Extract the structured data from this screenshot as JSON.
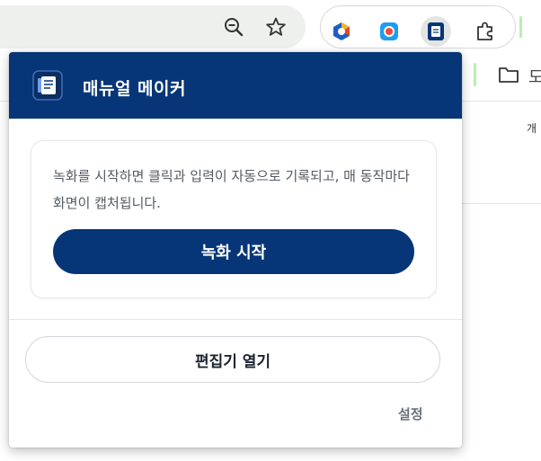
{
  "popup": {
    "title": "매뉴얼 메이커",
    "description": "녹화를 시작하면 클릭과 입력이 자동으로 기록되고, 매 동작마다 화면이 캡처됩니다.",
    "start_button": "녹화 시작",
    "open_editor_button": "편집기 열기",
    "settings_link": "설정"
  },
  "browser": {
    "bookmark_label": "도",
    "page_fragment_text": "개",
    "icons": [
      "zoom-out-icon",
      "star-icon",
      "extension-1-icon",
      "extension-2-icon",
      "manual-maker-icon",
      "puzzle-icon",
      "folder-icon"
    ]
  },
  "colors": {
    "brand": "#063677",
    "accent_green": "#b9eeb0"
  }
}
